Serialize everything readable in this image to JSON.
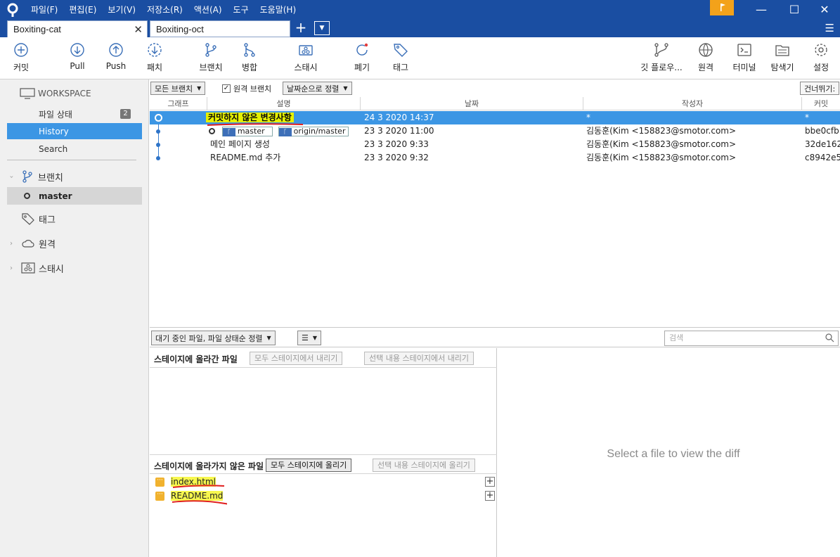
{
  "titlebar": {
    "menu": [
      "파일(F)",
      "편집(E)",
      "보기(V)",
      "저장소(R)",
      "액션(A)",
      "도구",
      "도움말(H)"
    ],
    "win_min": "—",
    "win_max": "☐",
    "win_close": "✕"
  },
  "tabs": [
    {
      "label": "Boxiting-cat",
      "active": true
    },
    {
      "label": "Boxiting-oct",
      "active": false
    }
  ],
  "tab_close": "✕",
  "tab_add": "+",
  "tab_dropdown": "▼",
  "hamburger": "☰",
  "toolbar": {
    "commit": "커밋",
    "pull": "Pull",
    "push": "Push",
    "fetch": "패치",
    "branch": "브랜치",
    "merge": "병합",
    "stash": "스태시",
    "discard": "폐기",
    "tag": "태그",
    "gitflow": "깃 플로우...",
    "remote": "원격",
    "terminal": "터미널",
    "explorer": "탐색기",
    "settings": "설정"
  },
  "sidebar": {
    "workspace": "WORKSPACE",
    "file_status": "파일 상태",
    "file_status_count": "2",
    "history": "History",
    "search": "Search",
    "branches": "브랜치",
    "master": "master",
    "tags": "태그",
    "remotes": "원격",
    "stashes": "스태시"
  },
  "filter": {
    "branches": "모든 브랜치",
    "remote_branches": "원격 브랜치",
    "remote_checked": true,
    "sort": "날짜순으로 정렬",
    "jump": "건너뛰기:"
  },
  "history": {
    "columns": [
      "그래프",
      "설명",
      "날짜",
      "작성자",
      "커밋"
    ],
    "rows": [
      {
        "desc": "커밋하지 않은 변경사항",
        "date": "24 3 2020 14:37",
        "author": "*",
        "commit": "*",
        "selected": true
      },
      {
        "desc": "",
        "refs": [
          "master",
          "origin/master"
        ],
        "date": "23 3 2020 11:00",
        "author": "김동훈(Kim <158823@smotor.com>",
        "commit": "bbe0cfb"
      },
      {
        "desc": "메인 페이지 생성",
        "date": "23 3 2020 9:33",
        "author": "김동훈(Kim <158823@smotor.com>",
        "commit": "32de162"
      },
      {
        "desc": "README.md 추가",
        "date": "23 3 2020 9:32",
        "author": "김동훈(Kim <158823@smotor.com>",
        "commit": "c8942e5"
      }
    ]
  },
  "lower": {
    "sort": "대기 중인 파일, 파일 상태순 정렬",
    "search_placeholder": "검색",
    "staged_title": "스테이지에 올라간 파일",
    "unstage_all": "모두 스테이지에서 내리기",
    "unstage_selected": "선택 내용 스테이지에서 내리기",
    "unstaged_title": "스테이지에 올라가지 않은 파일",
    "stage_all": "모두 스테이지에 올리기",
    "stage_selected": "선택 내용 스테이지에 올리기",
    "files": [
      {
        "name": "index.html",
        "badge": "···"
      },
      {
        "name": "README.md",
        "badge": "···"
      }
    ],
    "diff_placeholder": "Select a file to view the diff"
  },
  "colors": {
    "accent": "#3c96e4",
    "titlebar": "#1a4ea2",
    "highlight": "#e5f000",
    "file_badge": "#f1b22e"
  }
}
